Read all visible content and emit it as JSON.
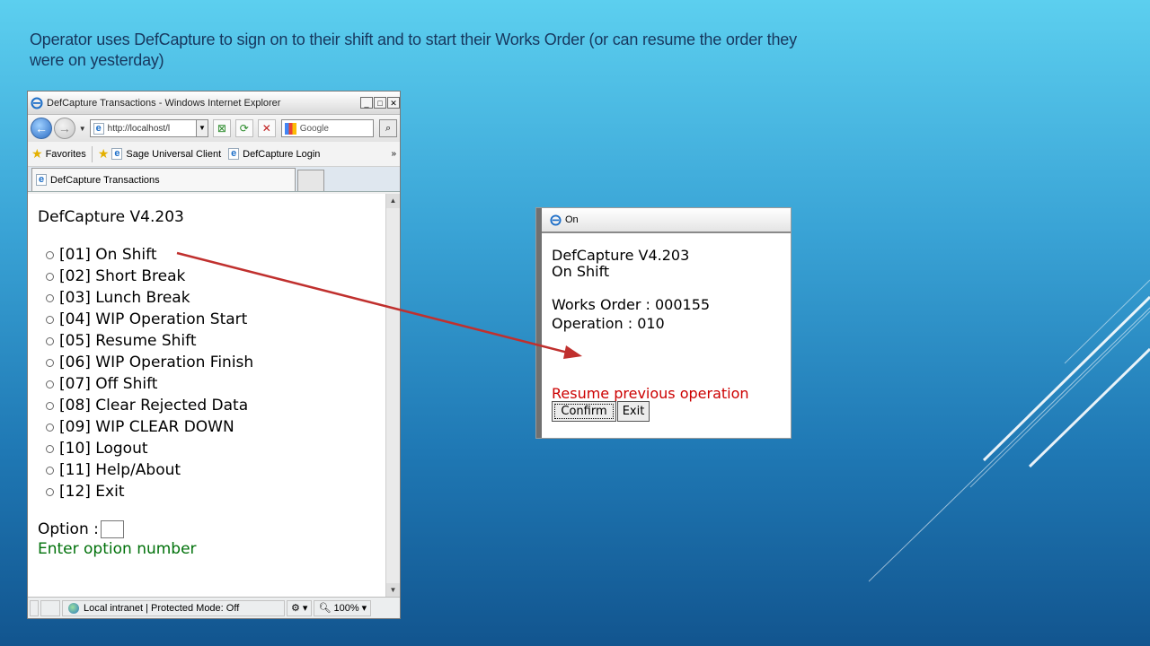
{
  "slide": {
    "caption": "Operator uses DefCapture to sign on to their shift and to start their Works Order (or can resume the order they were on yesterday)",
    "colors": {
      "background_top": "#5ccfef",
      "background_bottom": "#12558f",
      "arrow": "#c0302e",
      "caption_text": "#17375e"
    }
  },
  "ie_window": {
    "title": "DefCapture Transactions - Windows Internet Explorer",
    "address": "http://localhost/l",
    "search_placeholder": "Google",
    "favorites_label": "Favorites",
    "favorites": [
      "Sage Universal Client",
      "DefCapture Login"
    ],
    "tab_label": "DefCapture Transactions",
    "status_zone": "Local intranet | Protected Mode: Off",
    "zoom": "100%"
  },
  "app": {
    "title": "DefCapture V4.203",
    "menu": [
      "[01] On Shift",
      "[02] Short Break",
      "[03] Lunch Break",
      "[04] WIP Operation Start",
      "[05] Resume Shift",
      "[06] WIP Operation Finish",
      "[07] Off Shift",
      "[08] Clear Rejected Data",
      "[09] WIP CLEAR DOWN",
      "[10] Logout",
      "[11] Help/About",
      "[12] Exit"
    ],
    "option_label": "Option :",
    "option_value": "",
    "hint": "Enter option number",
    "hint_color": "#00710a"
  },
  "handheld": {
    "window_title": "On",
    "title": "DefCapture V4.203",
    "subtitle": "On Shift",
    "works_order": "Works Order : 000155",
    "operation": "Operation : 010",
    "message": "Resume previous operation",
    "message_color": "#cc0000",
    "confirm_label": "Confirm",
    "exit_label": "Exit"
  }
}
